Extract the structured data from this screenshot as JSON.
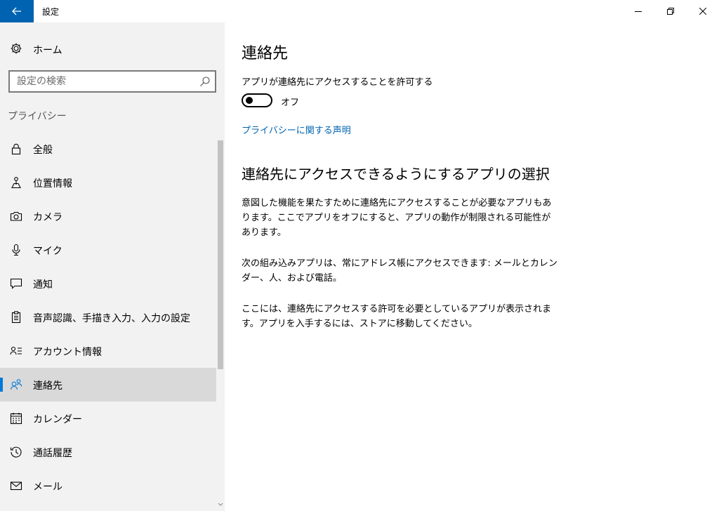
{
  "window": {
    "title": "設定"
  },
  "sidebar": {
    "home_label": "ホーム",
    "search_placeholder": "設定の検索",
    "section_title": "プライバシー",
    "items": [
      {
        "label": "全般",
        "icon": "lock-icon"
      },
      {
        "label": "位置情報",
        "icon": "location-icon"
      },
      {
        "label": "カメラ",
        "icon": "camera-icon"
      },
      {
        "label": "マイク",
        "icon": "microphone-icon"
      },
      {
        "label": "通知",
        "icon": "notification-icon"
      },
      {
        "label": "音声認識、手描き入力、入力の設定",
        "icon": "clipboard-icon"
      },
      {
        "label": "アカウント情報",
        "icon": "account-info-icon"
      },
      {
        "label": "連絡先",
        "icon": "contacts-icon",
        "active": true
      },
      {
        "label": "カレンダー",
        "icon": "calendar-icon"
      },
      {
        "label": "通話履歴",
        "icon": "history-icon"
      },
      {
        "label": "メール",
        "icon": "mail-icon"
      }
    ]
  },
  "main": {
    "title": "連絡先",
    "allow_label": "アプリが連絡先にアクセスすることを許可する",
    "toggle_state": "オフ",
    "toggle_on": false,
    "privacy_link": "プライバシーに関する声明",
    "choose_title": "連絡先にアクセスできるようにするアプリの選択",
    "paragraph1": "意図した機能を果たすために連絡先にアクセスすることが必要なアプリもあります。ここでアプリをオフにすると、アプリの動作が制限される可能性があります。",
    "paragraph2": "次の組み込みアプリは、常にアドレス帳にアクセスできます: メールとカレンダー、人、および電話。",
    "paragraph3": "ここには、連絡先にアクセスする許可を必要としているアプリが表示されます。アプリを入手するには、ストアに移動してください。"
  },
  "colors": {
    "accent": "#0078d7",
    "back_button": "#0063b1",
    "link": "#0063b1",
    "sidebar_bg": "#f2f2f2",
    "active_item_bg": "#d9d9d9"
  }
}
